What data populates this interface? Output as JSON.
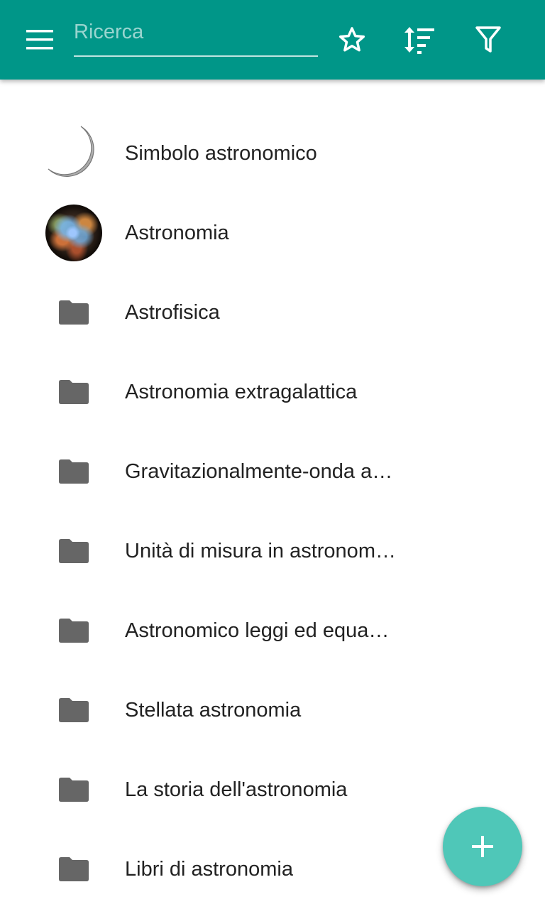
{
  "app": {
    "accent_color": "#009688",
    "fab_color": "#4fc7b8"
  },
  "toolbar": {
    "menu_icon": "menu-icon",
    "search": {
      "placeholder": "Ricerca",
      "value": ""
    },
    "actions": [
      {
        "name": "favorites",
        "icon": "star-outline-icon"
      },
      {
        "name": "sort",
        "icon": "sort-icon"
      },
      {
        "name": "filter",
        "icon": "filter-icon"
      }
    ]
  },
  "list": {
    "items": [
      {
        "label": "Simbolo astronomico",
        "icon": "crescent-moon-icon"
      },
      {
        "label": "Astronomia",
        "icon": "nebula-image"
      },
      {
        "label": "Astrofisica",
        "icon": "folder-icon"
      },
      {
        "label": "Astronomia extragalattica",
        "icon": "folder-icon"
      },
      {
        "label": "Gravitazionalmente-onda a…",
        "icon": "folder-icon"
      },
      {
        "label": "Unità di misura in astronom…",
        "icon": "folder-icon"
      },
      {
        "label": "Astronomico leggi ed equa…",
        "icon": "folder-icon"
      },
      {
        "label": "Stellata astronomia",
        "icon": "folder-icon"
      },
      {
        "label": "La storia dell'astronomia",
        "icon": "folder-icon"
      },
      {
        "label": "Libri di astronomia",
        "icon": "folder-icon"
      }
    ]
  },
  "fab": {
    "icon": "plus-icon"
  }
}
